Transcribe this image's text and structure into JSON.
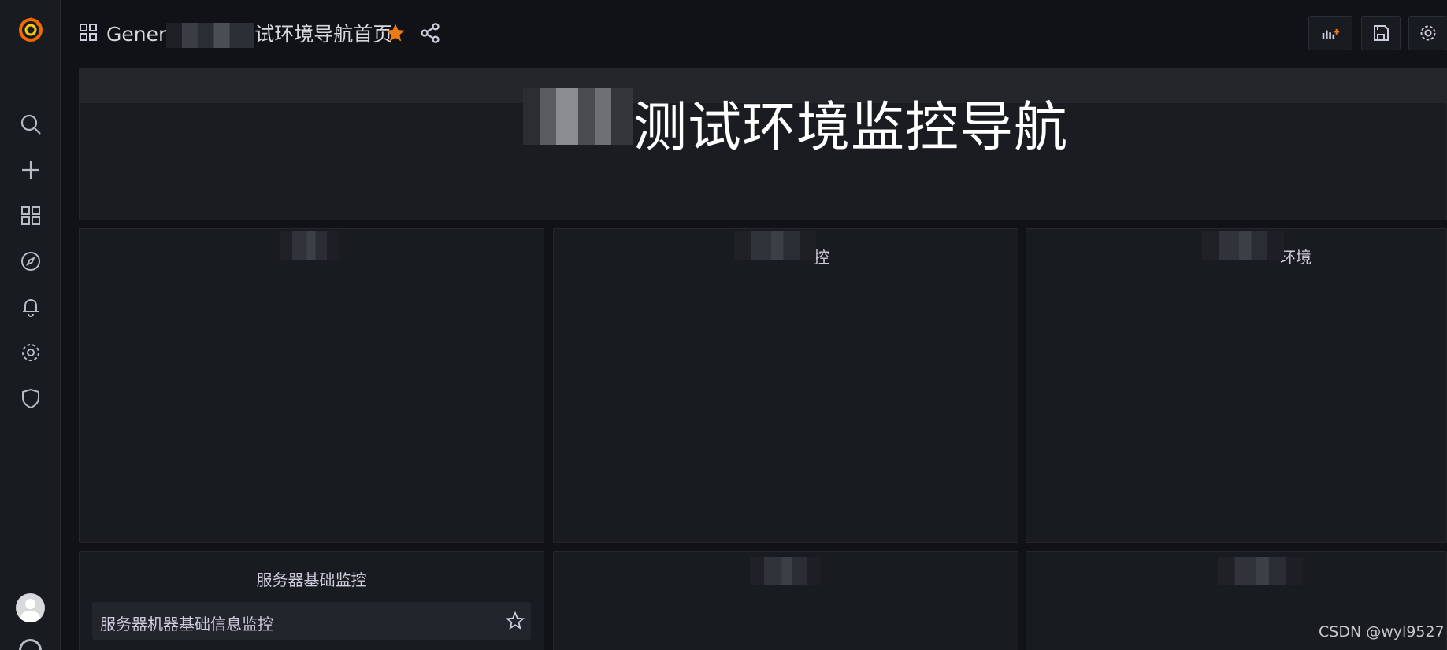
{
  "sidebar": {
    "icons": [
      "grafana-logo-icon",
      "search-icon",
      "plus-icon",
      "dashboards-icon",
      "explore-icon",
      "alerting-icon",
      "gear-icon",
      "shield-icon"
    ]
  },
  "header": {
    "title_prefix": "Gener",
    "title_suffix": "试环境导航首页",
    "starred": true
  },
  "banner": {
    "title": "测试环境监控导航"
  },
  "panels": [
    {
      "title": ""
    },
    {
      "title": "控"
    },
    {
      "title": "环境"
    },
    {
      "title": "服务器基础监控",
      "links": [
        {
          "label": "服务器机器基础信息监控"
        }
      ]
    },
    {
      "title": ""
    },
    {
      "title": ""
    }
  ],
  "colors": {
    "accent_star": "#eb7b18",
    "background": "#111217",
    "panel": "#181b1f"
  },
  "watermark": "CSDN @wyl9527"
}
